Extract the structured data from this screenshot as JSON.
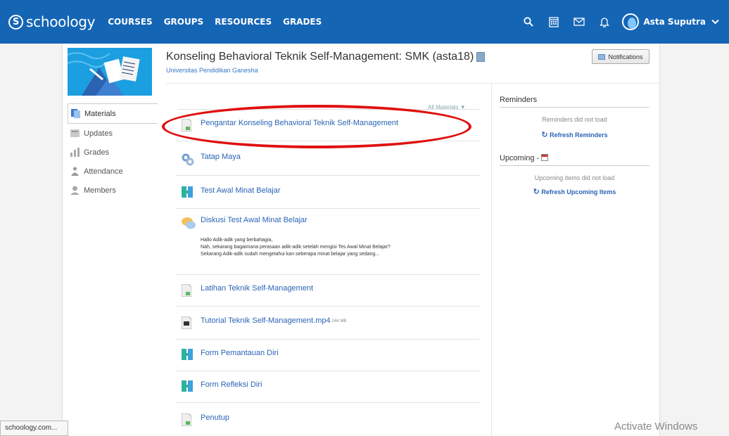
{
  "topnav": {
    "logo_text": "schoology",
    "logo_letter": "S",
    "items": [
      "COURSES",
      "GROUPS",
      "RESOURCES",
      "GRADES"
    ],
    "user_name": "Asta Suputra"
  },
  "sidebar": {
    "items": [
      {
        "label": "Materials",
        "icon": "materials-icon"
      },
      {
        "label": "Updates",
        "icon": "updates-icon"
      },
      {
        "label": "Grades",
        "icon": "grades-icon"
      },
      {
        "label": "Attendance",
        "icon": "attendance-icon"
      },
      {
        "label": "Members",
        "icon": "members-icon"
      }
    ]
  },
  "header": {
    "course_title": "Konseling Behavioral Teknik Self-Management: SMK (asta18)",
    "university": "Universitas Pendidikan Ganesha",
    "notifications_label": "Notifications"
  },
  "materials": {
    "filter_label": "All Materials ▼",
    "items": [
      {
        "title": "Pengantar Konseling Behavioral Teknik Self-Management",
        "type": "page"
      },
      {
        "title": "Tatap Maya",
        "type": "link"
      },
      {
        "title": "Test Awal Minat Belajar",
        "type": "assessment"
      },
      {
        "title": "Diskusi Test Awal Minat Belajar",
        "type": "discussion",
        "description": [
          "Hallo Adik-adik yang berbahagia,",
          "Nah, sekarang bagaimana perasaan adik-adik setelah mengisi Tes Awal Minat Belajar?",
          "Sekarang Adik-adik sudah mengetahui kan seberapa minat belajar yang sedang..."
        ]
      },
      {
        "title": "Latihan Teknik Self-Management",
        "type": "page"
      },
      {
        "title": "Tutorial Teknik Self-Management.mp4",
        "type": "file",
        "size": "244 MB"
      },
      {
        "title": "Form Pemantauan Diri",
        "type": "assessment"
      },
      {
        "title": "Form Refleksi Diri",
        "type": "assessment"
      },
      {
        "title": "Penutup",
        "type": "page"
      }
    ]
  },
  "reminders": {
    "heading": "Reminders",
    "message": "Reminders did not load",
    "refresh_label": "Refresh Reminders"
  },
  "upcoming": {
    "heading": "Upcoming -",
    "message": "Upcoming items did not load",
    "refresh_label": "Refresh Upcoming Items"
  },
  "statusbar": {
    "text": "schoology.com..."
  },
  "watermark": {
    "text": "Activate Windows"
  },
  "colors": {
    "nav_bg": "#1565b5",
    "link": "#2a64b5",
    "annotation": "#e01010"
  }
}
